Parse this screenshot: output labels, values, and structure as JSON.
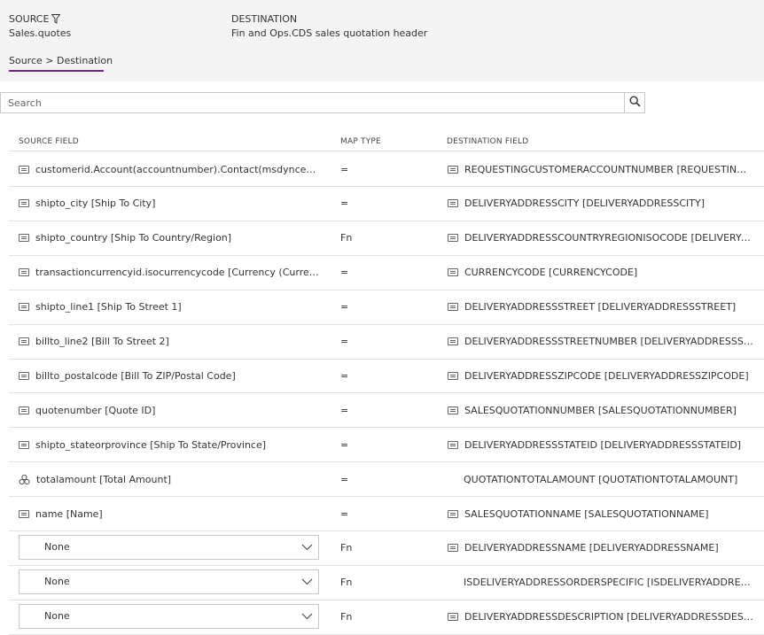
{
  "header": {
    "source_label": "SOURCE",
    "source_value": "Sales.quotes",
    "destination_label": "DESTINATION",
    "destination_value": "Fin and Ops.CDS sales quotation header",
    "breadcrumb": "Source > Destination"
  },
  "search": {
    "placeholder": "Search"
  },
  "columns": {
    "source_field": "SOURCE FIELD",
    "map_type": "MAP TYPE",
    "destination_field": "DESTINATION FIELD"
  },
  "rows": [
    {
      "source": "customerid.Account(accountnumber).Contact(msdynce_contactnumber) [Customer]",
      "source_icon": "field-icon",
      "map_type": "=",
      "destination": "REQUESTINGCUSTOMERACCOUNTNUMBER [REQUESTINGCUSTOMERACCOUNTNUMBER]",
      "destination_icon": "field-icon"
    },
    {
      "source": "shipto_city [Ship To City]",
      "source_icon": "field-icon",
      "map_type": "=",
      "destination": "DELIVERYADDRESSCITY [DELIVERYADDRESSCITY]",
      "destination_icon": "field-icon"
    },
    {
      "source": "shipto_country [Ship To Country/Region]",
      "source_icon": "field-icon",
      "map_type": "Fn",
      "destination": "DELIVERYADDRESSCOUNTRYREGIONISOCODE [DELIVERYADDRESSCOUNTRYREGIONISOCODE]",
      "destination_icon": "field-icon"
    },
    {
      "source": "transactioncurrencyid.isocurrencycode [Currency (Currency Code)]",
      "source_icon": "field-icon",
      "map_type": "=",
      "destination": "CURRENCYCODE [CURRENCYCODE]",
      "destination_icon": "field-icon"
    },
    {
      "source": "shipto_line1 [Ship To Street 1]",
      "source_icon": "field-icon",
      "map_type": "=",
      "destination": "DELIVERYADDRESSSTREET [DELIVERYADDRESSSTREET]",
      "destination_icon": "field-icon"
    },
    {
      "source": "billto_line2 [Bill To Street 2]",
      "source_icon": "field-icon",
      "map_type": "=",
      "destination": "DELIVERYADDRESSSTREETNUMBER [DELIVERYADDRESSSTREETNUMBER]",
      "destination_icon": "field-icon"
    },
    {
      "source": "billto_postalcode [Bill To ZIP/Postal Code]",
      "source_icon": "field-icon",
      "map_type": "=",
      "destination": "DELIVERYADDRESSZIPCODE [DELIVERYADDRESSZIPCODE]",
      "destination_icon": "field-icon"
    },
    {
      "source": "quotenumber [Quote ID]",
      "source_icon": "field-icon",
      "map_type": "=",
      "destination": "SALESQUOTATIONNUMBER [SALESQUOTATIONNUMBER]",
      "destination_icon": "field-icon"
    },
    {
      "source": "shipto_stateorprovince [Ship To State/Province]",
      "source_icon": "field-icon",
      "map_type": "=",
      "destination": "DELIVERYADDRESSSTATEID [DELIVERYADDRESSSTATEID]",
      "destination_icon": "field-icon"
    },
    {
      "source": "totalamount [Total Amount]",
      "source_icon": "currency-icon",
      "map_type": "=",
      "destination": "QUOTATIONTOTALAMOUNT [QUOTATIONTOTALAMOUNT]",
      "destination_icon": ""
    },
    {
      "source": "name [Name]",
      "source_icon": "field-icon",
      "map_type": "=",
      "destination": "SALESQUOTATIONNAME [SALESQUOTATIONNAME]",
      "destination_icon": "field-icon"
    }
  ],
  "dropdown_rows": [
    {
      "selected": "None",
      "map_type": "Fn",
      "destination": "DELIVERYADDRESSNAME [DELIVERYADDRESSNAME]",
      "destination_icon": "field-icon"
    },
    {
      "selected": "None",
      "map_type": "Fn",
      "destination": "ISDELIVERYADDRESSORDERSPECIFIC [ISDELIVERYADDRESSORDERSPECIFIC]",
      "destination_icon": ""
    },
    {
      "selected": "None",
      "map_type": "Fn",
      "destination": "DELIVERYADDRESSDESCRIPTION [DELIVERYADDRESSDESCRIPTION]",
      "destination_icon": "field-icon"
    }
  ],
  "colors": {
    "accent": "#6b2a7a",
    "header_bg": "#f4f4f4",
    "row_border": "#e1e1e1"
  }
}
